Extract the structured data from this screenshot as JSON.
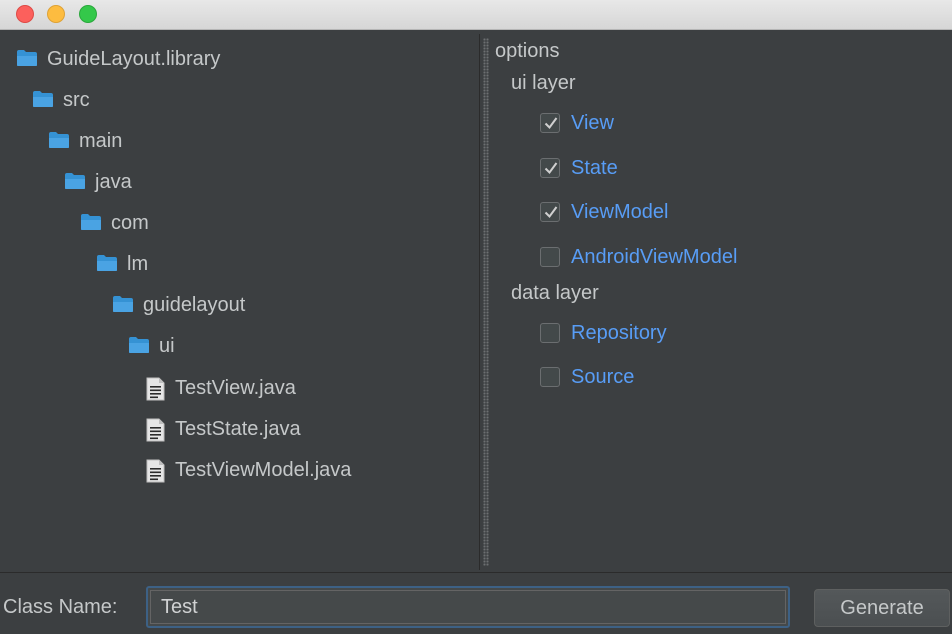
{
  "window": {
    "controls": [
      "close",
      "minimize",
      "maximize"
    ]
  },
  "tree": {
    "items": [
      {
        "label": "GuideLayout.library",
        "icon": "folder-icon"
      },
      {
        "label": "src",
        "icon": "folder-icon"
      },
      {
        "label": "main",
        "icon": "folder-icon"
      },
      {
        "label": "java",
        "icon": "folder-icon"
      },
      {
        "label": "com",
        "icon": "folder-icon"
      },
      {
        "label": "lm",
        "icon": "folder-icon"
      },
      {
        "label": "guidelayout",
        "icon": "folder-icon"
      },
      {
        "label": "ui",
        "icon": "folder-icon"
      },
      {
        "label": "TestView.java",
        "icon": "file-icon"
      },
      {
        "label": "TestState.java",
        "icon": "file-icon"
      },
      {
        "label": "TestViewModel.java",
        "icon": "file-icon"
      }
    ]
  },
  "options": {
    "title": "options",
    "ui_layer": {
      "label": "ui layer",
      "items": [
        {
          "label": "View",
          "checked": true
        },
        {
          "label": "State",
          "checked": true
        },
        {
          "label": "ViewModel",
          "checked": true
        },
        {
          "label": "AndroidViewModel",
          "checked": false
        }
      ]
    },
    "data_layer": {
      "label": "data layer",
      "items": [
        {
          "label": "Repository",
          "checked": false
        },
        {
          "label": "Source",
          "checked": false
        }
      ]
    }
  },
  "footer": {
    "class_name_label": "Class Name:",
    "class_name_value": "Test",
    "generate_label": "Generate"
  },
  "colors": {
    "background": "#3c3f41",
    "link": "#589df6",
    "folder": "#3592d4",
    "text": "#c5c8c9"
  }
}
